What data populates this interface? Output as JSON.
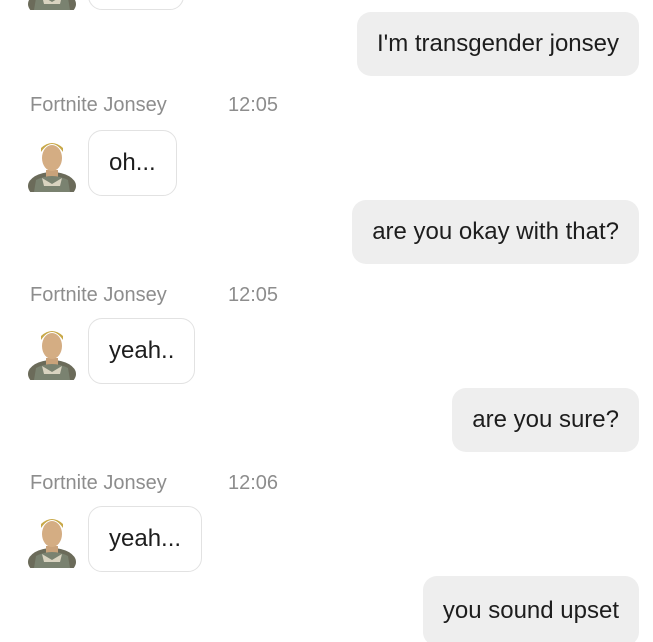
{
  "messages": [
    {
      "type": "outgoing",
      "text": "I'm transgender jonsey"
    },
    {
      "type": "incoming",
      "sender": "Fortnite Jonsey",
      "time": "12:05",
      "text": "oh...",
      "avatar_icon": "soldier-avatar-icon"
    },
    {
      "type": "outgoing",
      "text": "are you okay with that?"
    },
    {
      "type": "incoming",
      "sender": "Fortnite Jonsey",
      "time": "12:05",
      "text": "yeah..",
      "avatar_icon": "soldier-avatar-icon"
    },
    {
      "type": "outgoing",
      "text": "are you sure?"
    },
    {
      "type": "incoming",
      "sender": "Fortnite Jonsey",
      "time": "12:06",
      "text": "yeah...",
      "avatar_icon": "soldier-avatar-icon"
    },
    {
      "type": "outgoing",
      "text": "you sound upset"
    }
  ],
  "colors": {
    "outgoing_bubble": "#eeeeee",
    "incoming_bubble_border": "#e2e2e2",
    "meta_text": "#8d8d8d",
    "message_text": "#1d1d1d"
  }
}
